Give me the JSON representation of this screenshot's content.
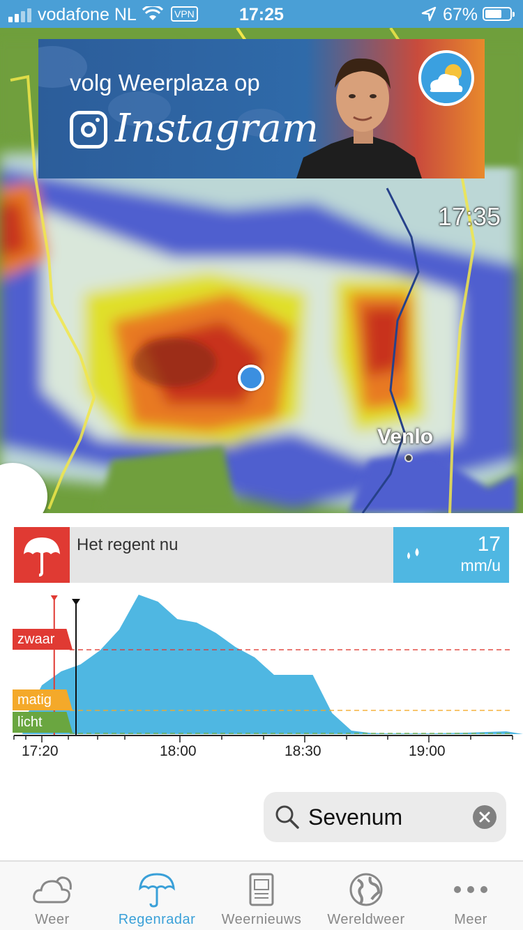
{
  "status_bar": {
    "carrier": "vodafone NL",
    "vpn": "VPN",
    "time": "17:25",
    "battery": "67%",
    "battery_level": 0.67
  },
  "banner": {
    "line1": "volg Weerplaza op",
    "line2": "Instagram"
  },
  "map": {
    "time": "17:35",
    "city": "Venlo"
  },
  "rain_info": {
    "text": "Het regent nu",
    "amount": "17",
    "unit": "mm/u"
  },
  "chart_data": {
    "type": "area",
    "x_ticks": [
      "17:20",
      "18:00",
      "18:30",
      "19:00"
    ],
    "levels": [
      "zwaar",
      "matig",
      "licht"
    ],
    "current_time": "17:25",
    "selected_time": "17:35",
    "x": [
      "17:15",
      "17:20",
      "17:25",
      "17:30",
      "17:35",
      "17:40",
      "17:45",
      "17:50",
      "17:55",
      "18:00",
      "18:05",
      "18:10",
      "18:15",
      "18:20",
      "18:25",
      "18:30",
      "18:35",
      "18:40",
      "18:45",
      "18:50",
      "18:55",
      "19:00",
      "19:05",
      "19:10",
      "19:15",
      "19:20"
    ],
    "values": [
      3,
      14,
      18,
      20,
      24,
      30,
      40,
      38,
      33,
      32,
      29,
      25,
      22,
      17,
      17,
      17,
      6,
      1,
      0.3,
      0.2,
      0.2,
      0.2,
      0.3,
      0.4,
      0.6,
      0.8
    ]
  },
  "search": {
    "value": "Sevenum"
  },
  "tabs": [
    {
      "label": "Weer",
      "icon": "cloud-icon"
    },
    {
      "label": "Regenradar",
      "icon": "umbrella-icon"
    },
    {
      "label": "Weernieuws",
      "icon": "newspaper-icon"
    },
    {
      "label": "Wereldweer",
      "icon": "globe-icon"
    },
    {
      "label": "Meer",
      "icon": "more-icon"
    }
  ],
  "colors": {
    "accent": "#3aa0d8",
    "rain_fill": "#4fb7e2",
    "heavy": "#e03a33",
    "moderate": "#f4a92a",
    "light": "#6aa640"
  }
}
